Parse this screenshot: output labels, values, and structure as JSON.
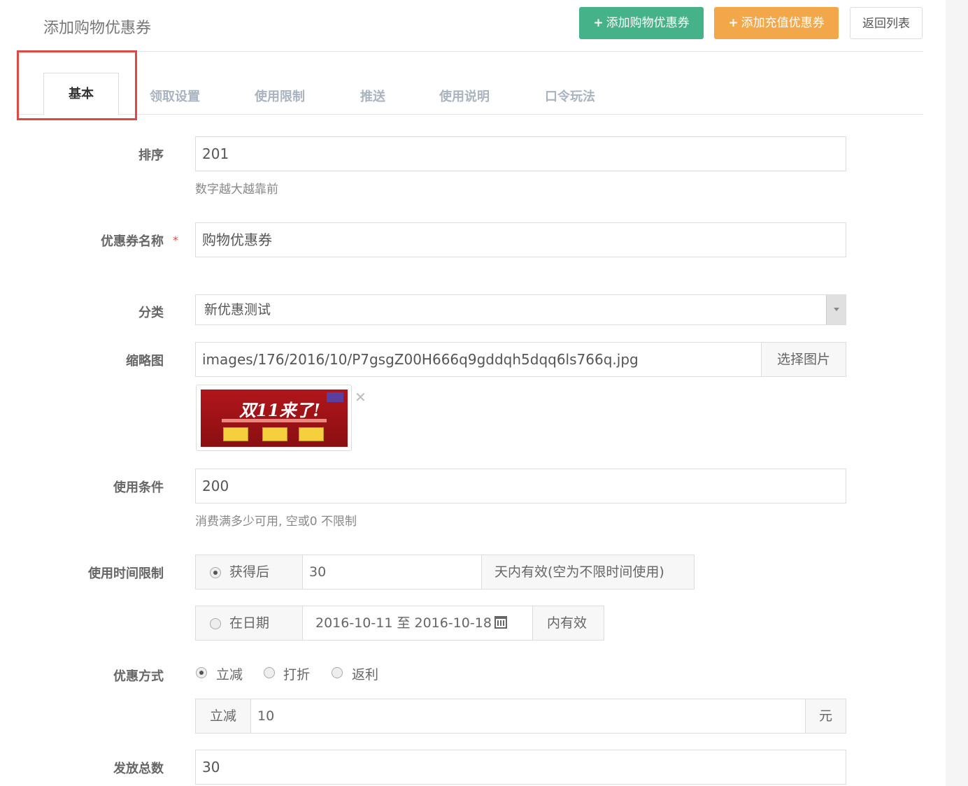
{
  "header": {
    "title": "添加购物优惠券",
    "buttons": {
      "add_shopping": "添加购物优惠券",
      "add_recharge": "添加充值优惠券",
      "back": "返回列表"
    }
  },
  "tabs": [
    {
      "label": "基本",
      "active": true
    },
    {
      "label": "领取设置"
    },
    {
      "label": "使用限制"
    },
    {
      "label": "推送"
    },
    {
      "label": "使用说明"
    },
    {
      "label": "口令玩法"
    }
  ],
  "form": {
    "sort": {
      "label": "排序",
      "value": "201",
      "help": "数字越大越靠前"
    },
    "name": {
      "label": "优惠券名称",
      "required_mark": "*",
      "value": "购物优惠券"
    },
    "category": {
      "label": "分类",
      "value": "新优惠测试"
    },
    "thumbnail": {
      "label": "缩略图",
      "value": "images/176/2016/10/P7gsgZ00H666q9gddqh5dqq6ls766q.jpg",
      "button": "选择图片",
      "preview_text": "双11来了!"
    },
    "condition": {
      "label": "使用条件",
      "value": "200",
      "help": "消费满多少可用, 空或0 不限制"
    },
    "time_limit": {
      "label": "使用时间限制",
      "after_option": "获得后",
      "days_value": "30",
      "days_suffix": "天内有效(空为不限时间使用)",
      "date_option": "在日期",
      "date_range": "2016-10-11 至 2016-10-18",
      "date_suffix": "内有效"
    },
    "discount": {
      "label": "优惠方式",
      "options": [
        "立减",
        "打折",
        "返利"
      ],
      "prefix": "立减",
      "value": "10",
      "unit": "元"
    },
    "total": {
      "label": "发放总数",
      "value": "30"
    }
  },
  "colors": {
    "green_button": "#45b28a",
    "orange_button": "#f2a74a",
    "highlight_box": "#e04848"
  }
}
